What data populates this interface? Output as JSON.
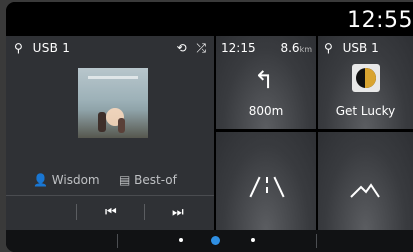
{
  "status": {
    "time": "12:55"
  },
  "media": {
    "source_label": "USB 1",
    "artist": "Wisdom",
    "album": "Best-of",
    "repeat_icon": "repeat-icon",
    "shuffle_icon": "shuffle-icon"
  },
  "nav": {
    "time": "12:15",
    "distance": "8.6",
    "distance_unit": "km",
    "turn_distance": "800m"
  },
  "music": {
    "source_label": "USB 1",
    "title": "Get Lucky"
  },
  "pagination": {
    "pages": 3,
    "active_page": 2
  },
  "colors": {
    "accent": "#2f8fe3",
    "tile": "#303236",
    "background": "#000000"
  }
}
